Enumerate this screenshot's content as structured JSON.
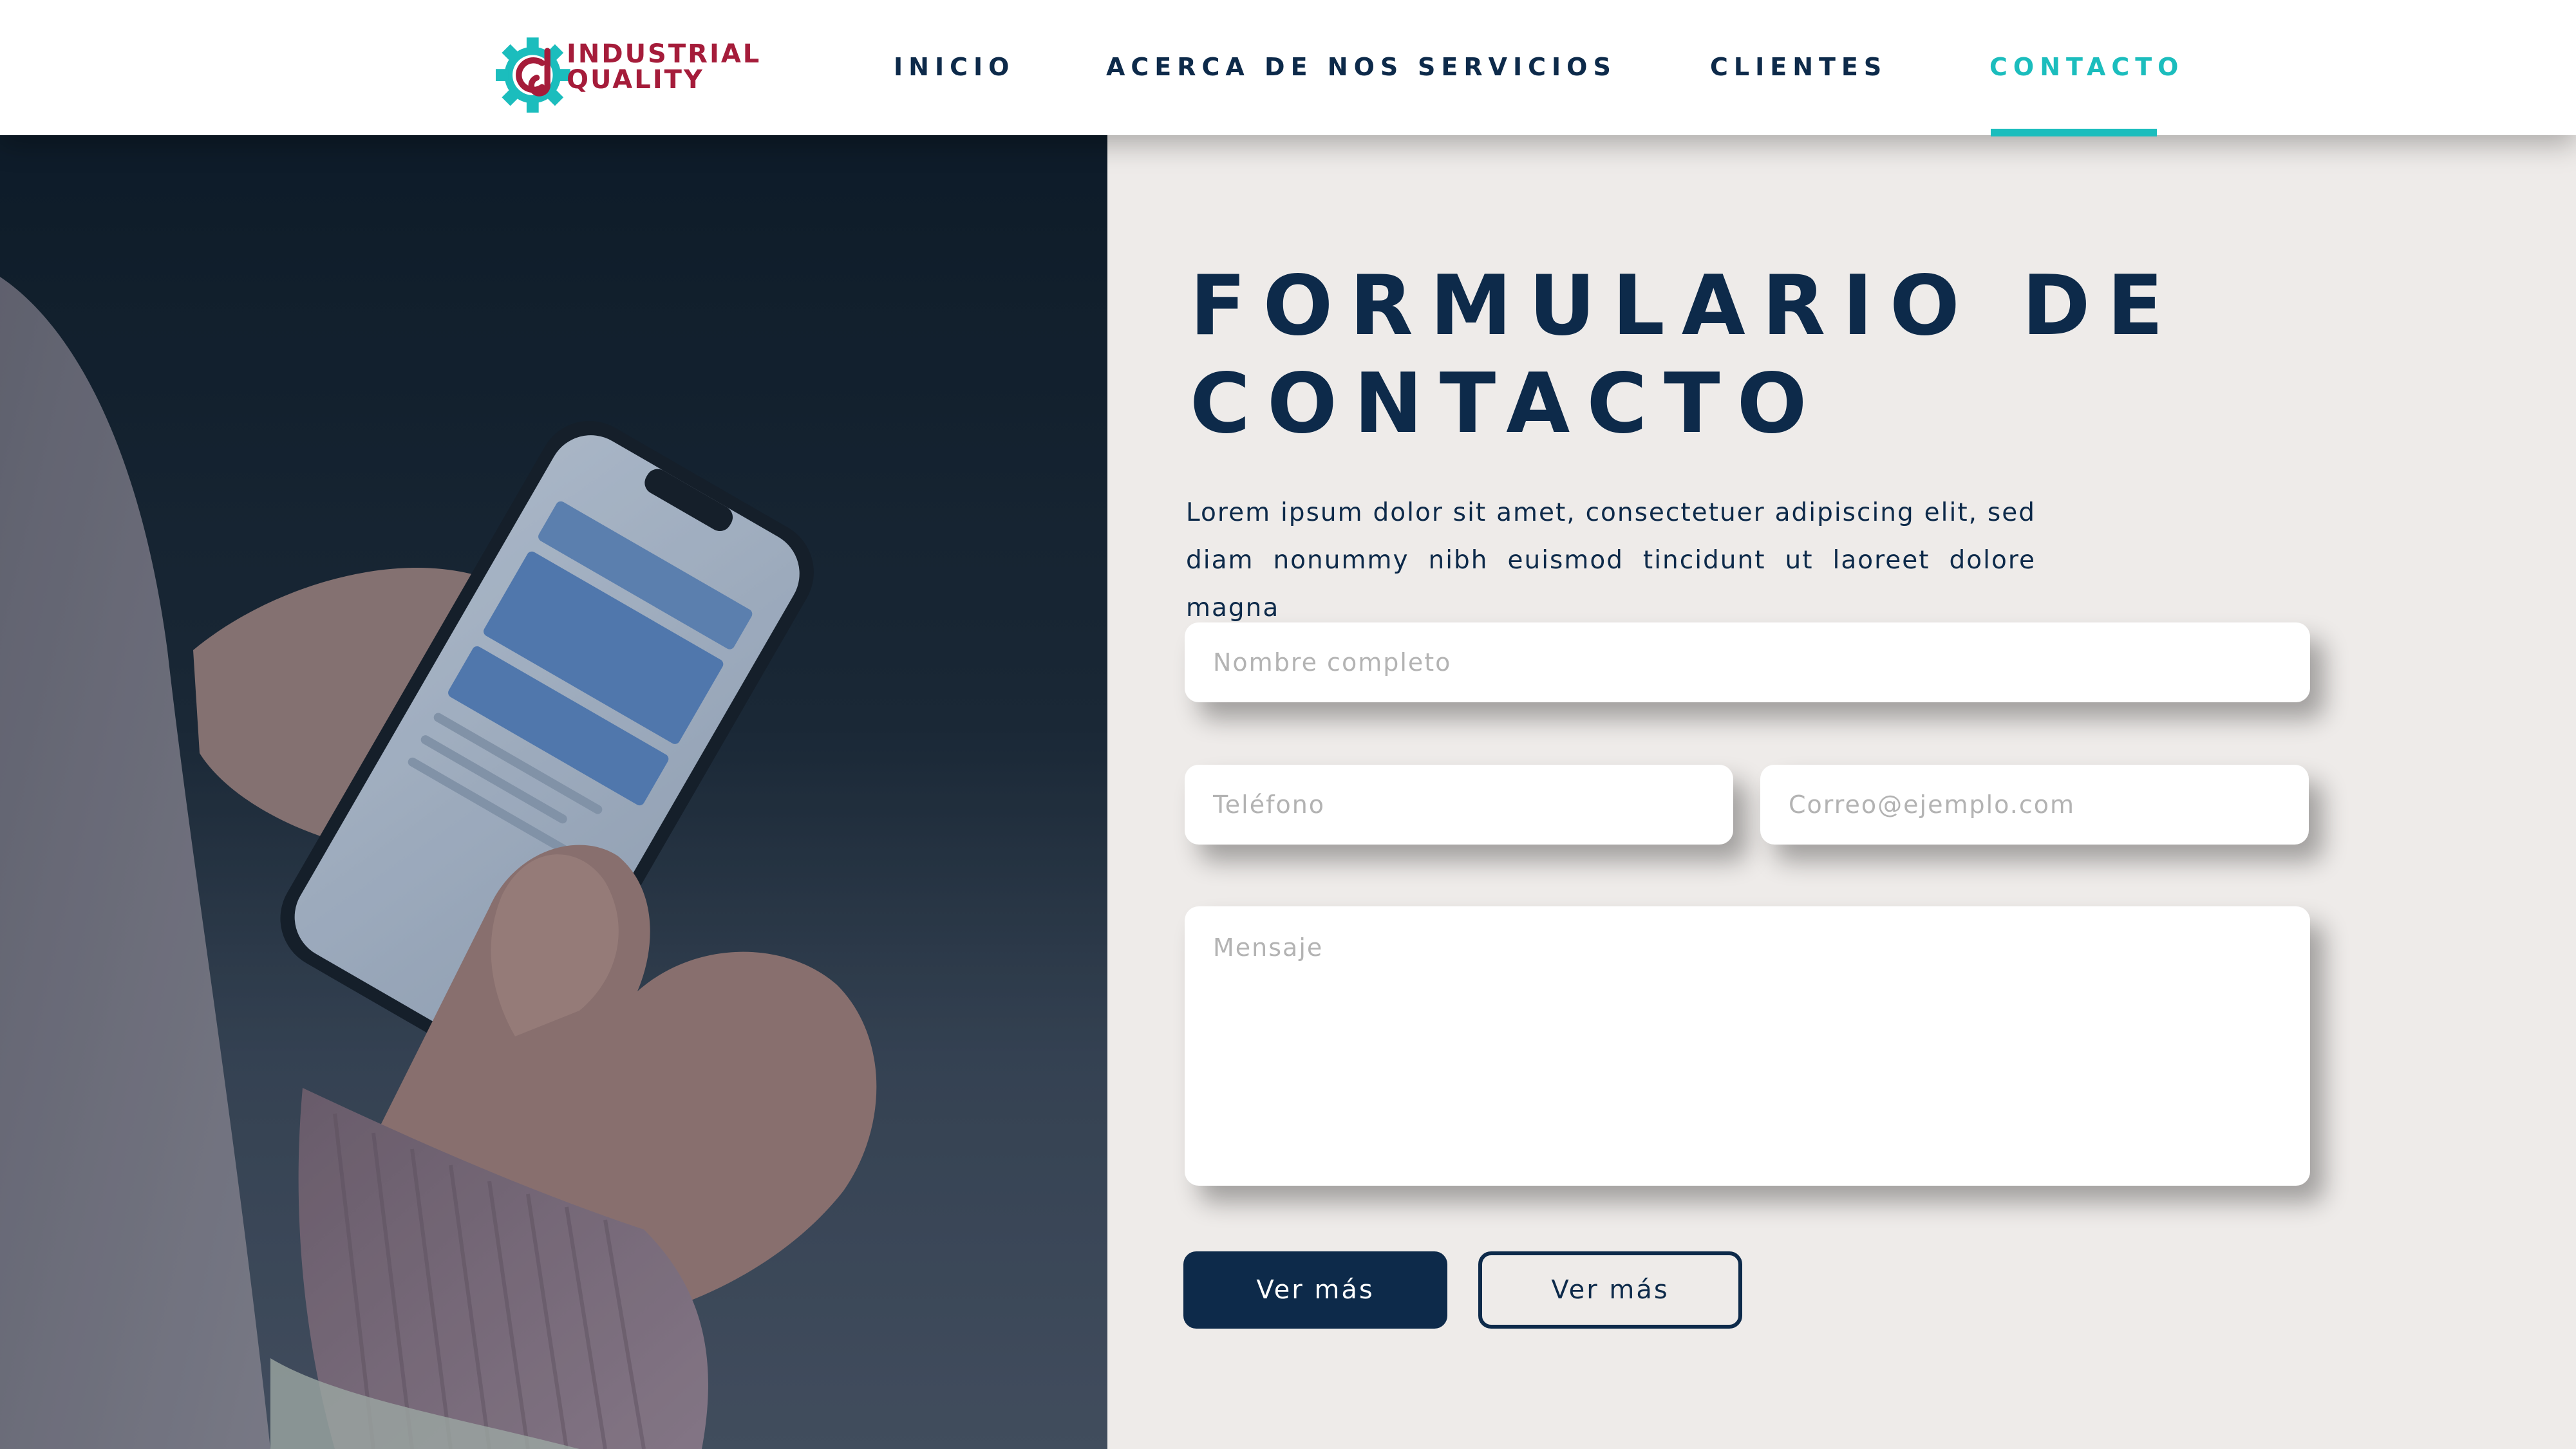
{
  "brand": {
    "name_line1": "INDUSTRIAL",
    "name_line2": "QUALITY",
    "logo_icon": "gear-logo-icon",
    "colors": {
      "red": "#a51c3a",
      "teal": "#1bbdbd"
    }
  },
  "nav": {
    "items": [
      {
        "label": "INICIO"
      },
      {
        "label": "ACERCA DE NOS"
      },
      {
        "label": "SERVICIOS"
      },
      {
        "label": "CLIENTES"
      },
      {
        "label": "CONTACTO",
        "active": true
      }
    ]
  },
  "hero_image": {
    "description_icon": "person-holding-smartphone"
  },
  "form": {
    "title_line1": "FORMULARIO DE",
    "title_line2": "CONTACTO",
    "lead": "Lorem ipsum dolor sit amet, consectetuer adipiscing elit, sed diam nonummy nibh euismod tincidunt ut laoreet dolore magna",
    "name_placeholder": "Nombre completo",
    "phone_placeholder": "Teléfono",
    "email_placeholder": "Correo@ejemplo.com",
    "message_placeholder": "Mensaje",
    "primary_button": "Ver más",
    "secondary_button": "Ver más"
  },
  "colors": {
    "navy": "#0d2a4a",
    "accent": "#1bbdbd",
    "panel_bg": "#eeebe9"
  }
}
